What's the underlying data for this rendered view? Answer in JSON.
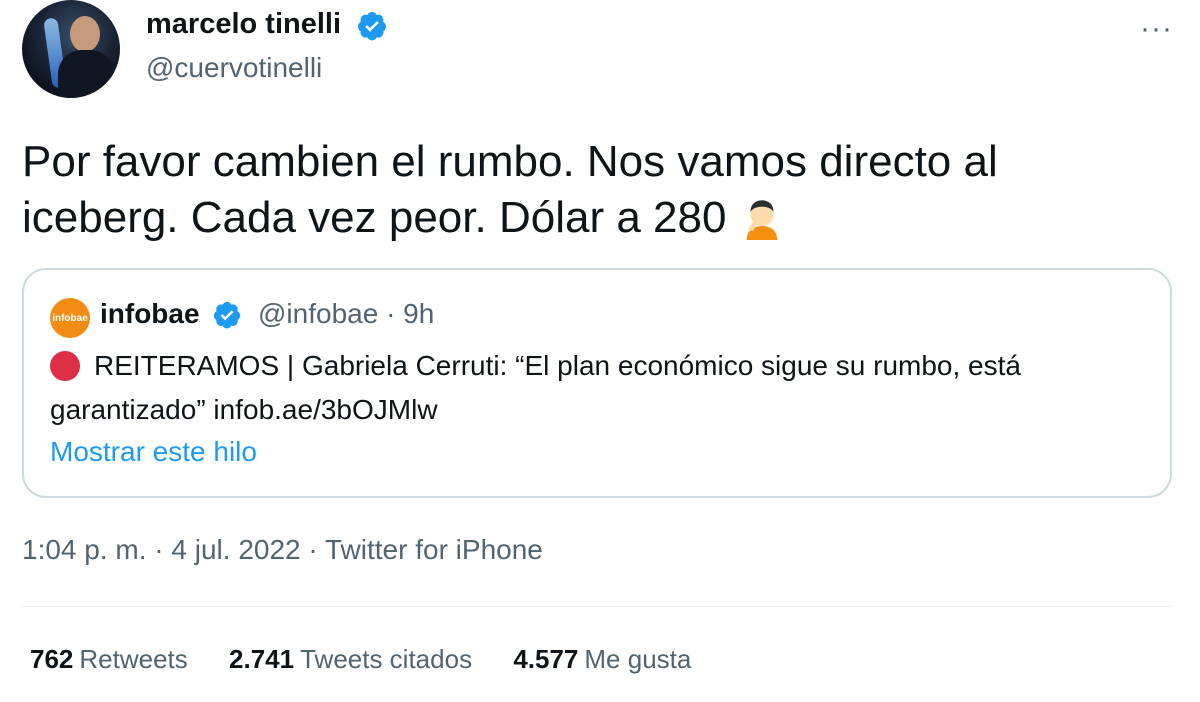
{
  "author": {
    "name": "marcelo tinelli",
    "handle": "@cuervotinelli",
    "verified_color": "#1d9bf0"
  },
  "menu_icon": "more-dots-icon",
  "tweet": {
    "text": "Por favor cambien el rumbo. Nos vamos directo al iceberg. Cada vez peor. Dólar a 280",
    "emoji": "person-facepalming-icon"
  },
  "quoted_tweet": {
    "logo_text": "infobae",
    "name": "infobae",
    "handle": "@infobae · 9h",
    "text": "REITERAMOS | Gabriela Cerruti: “El plan económico sigue su rumbo, está garantizado” infob.ae/3bOJMlw",
    "show_thread": "Mostrar este hilo",
    "status_dot_color": "#dd2e44"
  },
  "meta": {
    "timestamp": "1:04 p. m. · 4 jul. 2022 · Twitter for iPhone"
  },
  "stats": {
    "retweets_count": "762",
    "retweets_label": "Retweets",
    "quotes_count": "2.741",
    "quotes_label": "Tweets citados",
    "likes_count": "4.577",
    "likes_label": "Me gusta"
  },
  "colors": {
    "text": "#0f1419",
    "secondary": "#536471",
    "link": "#1d9bf0",
    "border": "#cfd9de"
  }
}
